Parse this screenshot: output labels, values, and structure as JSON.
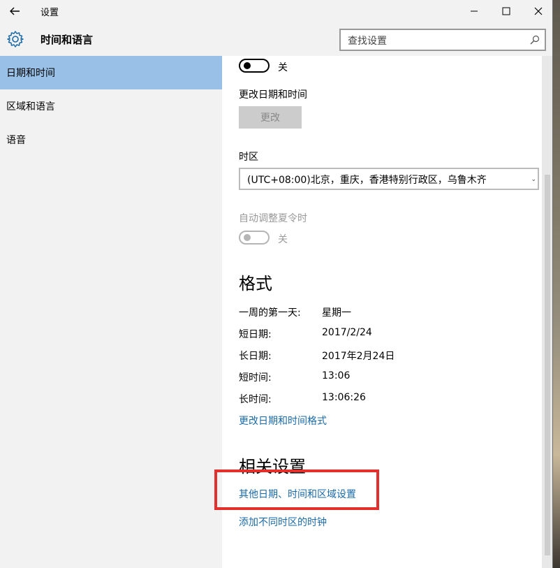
{
  "window": {
    "title": "设置"
  },
  "header": {
    "section_title": "时间和语言",
    "search_placeholder": "查找设置"
  },
  "sidebar": {
    "items": [
      {
        "label": "日期和时间",
        "selected": true
      },
      {
        "label": "区域和语言",
        "selected": false
      },
      {
        "label": "语音",
        "selected": false
      }
    ]
  },
  "content": {
    "toggle1_state": "关",
    "change_datetime_label": "更改日期和时间",
    "change_button": "更改",
    "timezone_label": "时区",
    "timezone_value": "(UTC+08:00)北京，重庆，香港特别行政区，乌鲁木齐",
    "dst_label": "自动调整夏令时",
    "dst_state": "关",
    "format_heading": "格式",
    "formats": [
      {
        "label": "一周的第一天:",
        "value": "星期一"
      },
      {
        "label": "短日期:",
        "value": "2017/2/24"
      },
      {
        "label": "长日期:",
        "value": "2017年2月24日"
      },
      {
        "label": "短时间:",
        "value": "13:06"
      },
      {
        "label": "长时间:",
        "value": "13:06:26"
      }
    ],
    "change_format_link": "更改日期和时间格式",
    "related_heading": "相关设置",
    "related_links": [
      "其他日期、时间和区域设置",
      "添加不同时区的时钟"
    ]
  },
  "colors": {
    "accent": "#99c1e8",
    "link": "#1a6aa8",
    "highlight": "#e3302d"
  }
}
